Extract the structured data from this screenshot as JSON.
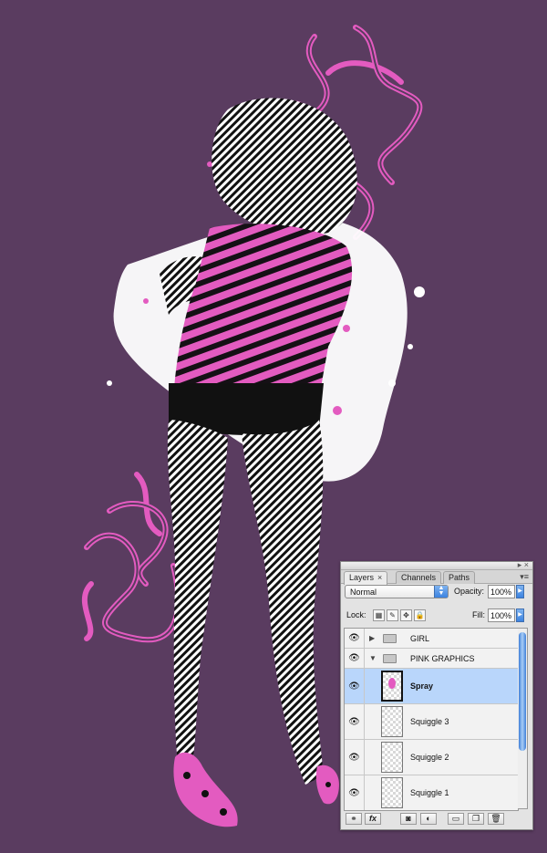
{
  "panel": {
    "tabs": [
      {
        "label": "Layers",
        "close": "×"
      },
      {
        "label": "Channels"
      },
      {
        "label": "Paths"
      }
    ],
    "blend_mode": "Normal",
    "opacity_label": "Opacity:",
    "opacity_value": "100%",
    "lock_label": "Lock:",
    "fill_label": "Fill:",
    "fill_value": "100%",
    "layers": [
      {
        "name": "GIRL",
        "type": "group",
        "expanded": false
      },
      {
        "name": "PINK GRAPHICS",
        "type": "group",
        "expanded": true
      },
      {
        "name": "Spray",
        "type": "layer",
        "selected": true
      },
      {
        "name": "Squiggle 3",
        "type": "layer"
      },
      {
        "name": "Squiggle 2",
        "type": "layer"
      },
      {
        "name": "Squiggle 1",
        "type": "layer"
      }
    ],
    "footer_fx": "fx"
  },
  "colors": {
    "background": "#5a3c60",
    "accent_pink": "#e35bc0",
    "selection": "#b9d6fb"
  }
}
